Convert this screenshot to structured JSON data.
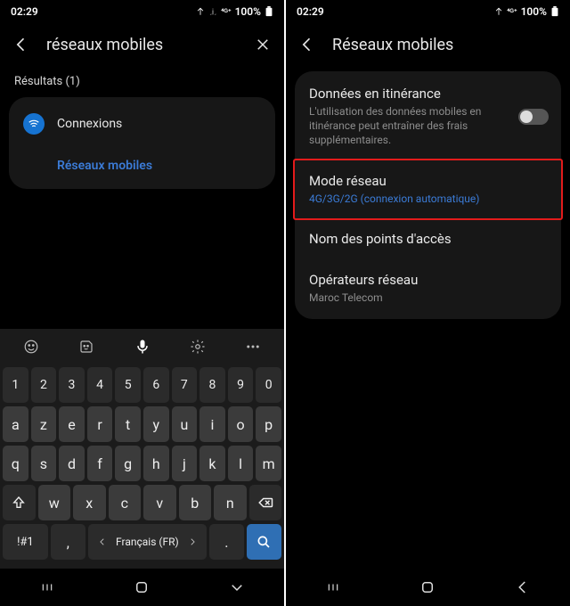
{
  "left": {
    "status": {
      "time": "02:29",
      "battery": "100%"
    },
    "header": {
      "query": "réseaux mobiles"
    },
    "results_label": "Résultats (1)",
    "result": {
      "category": "Connexions",
      "match": "Réseaux mobiles"
    },
    "keyboard": {
      "row_num": [
        "1",
        "2",
        "3",
        "4",
        "5",
        "6",
        "7",
        "8",
        "9",
        "0"
      ],
      "row1": [
        "a",
        "z",
        "e",
        "r",
        "t",
        "y",
        "u",
        "i",
        "o",
        "p"
      ],
      "row2": [
        "q",
        "s",
        "d",
        "f",
        "g",
        "h",
        "j",
        "k",
        "l",
        "m"
      ],
      "row3_letters": [
        "w",
        "x",
        "c",
        "v",
        "b",
        "n"
      ],
      "sym": "!#1",
      "lang": "Français (FR)",
      "comma": ",",
      "dot": "."
    }
  },
  "right": {
    "status": {
      "time": "02:29",
      "battery": "100%"
    },
    "header": {
      "title": "Réseaux mobiles"
    },
    "items": {
      "roaming": {
        "title": "Données en itinérance",
        "sub": "L'utilisation des données mobiles en itinérance peut entraîner des frais supplémentaires."
      },
      "mode": {
        "title": "Mode réseau",
        "sub": "4G/3G/2G (connexion automatique)"
      },
      "apn": {
        "title": "Nom des points d'accès"
      },
      "ops": {
        "title": "Opérateurs réseau",
        "sub": "Maroc Telecom"
      }
    }
  }
}
